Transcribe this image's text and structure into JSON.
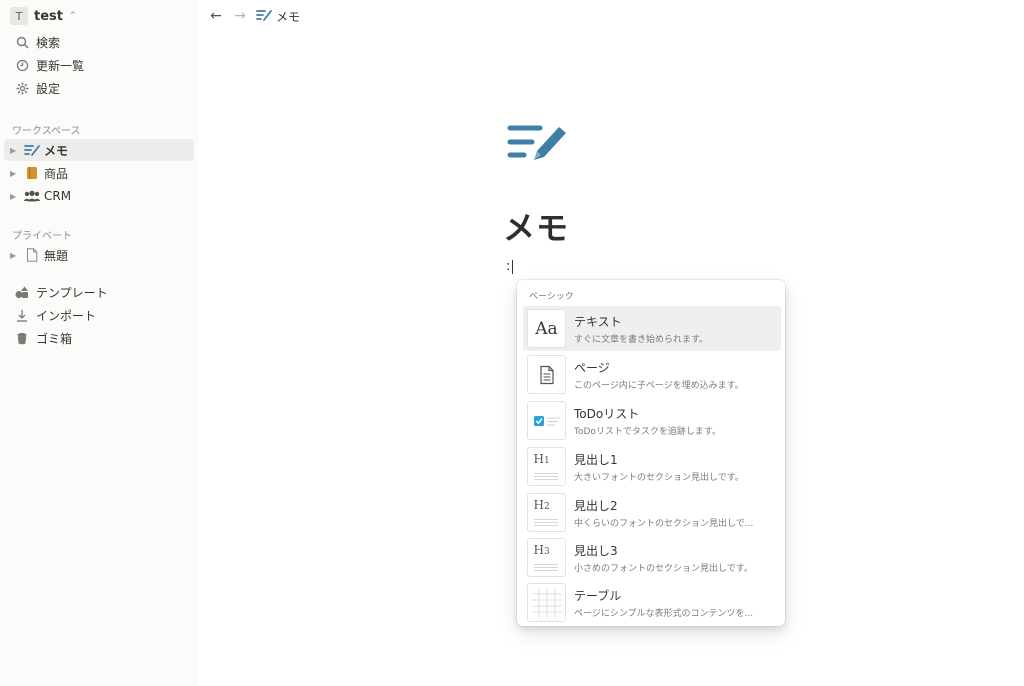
{
  "workspace": {
    "avatar_letter": "T",
    "name": "test",
    "switch_icon": "chevron-updown-icon"
  },
  "sidebar": {
    "top_items": [
      {
        "label": "検索",
        "icon": "search-icon"
      },
      {
        "label": "更新一覧",
        "icon": "clock-icon"
      },
      {
        "label": "設定",
        "icon": "gear-icon"
      }
    ],
    "workspace_section_label": "ワークスペース",
    "workspace_pages": [
      {
        "label": "メモ",
        "icon": "memo-pen-icon",
        "active": true
      },
      {
        "label": "商品",
        "icon": "book-icon",
        "active": false
      },
      {
        "label": "CRM",
        "icon": "people-icon",
        "active": false
      }
    ],
    "private_section_label": "プライベート",
    "private_pages": [
      {
        "label": "無題",
        "icon": "document-icon"
      }
    ],
    "bottom_items": [
      {
        "label": "テンプレート",
        "icon": "shapes-icon"
      },
      {
        "label": "インポート",
        "icon": "download-icon"
      },
      {
        "label": "ゴミ箱",
        "icon": "trash-icon"
      }
    ]
  },
  "topbar": {
    "back_icon": "arrow-left-icon",
    "forward_icon": "arrow-right-icon",
    "breadcrumb_label": "メモ"
  },
  "page": {
    "title": "メモ",
    "slash_text": ":",
    "icon_color": "#3f7fa6"
  },
  "menu": {
    "section_label": "ベーシック",
    "items": [
      {
        "title": "テキスト",
        "desc": "すぐに文章を書き始められます。",
        "thumb": "Aa"
      },
      {
        "title": "ページ",
        "desc": "このページ内に子ページを埋め込みます。",
        "thumb": "page-icon"
      },
      {
        "title": "ToDoリスト",
        "desc": "ToDoリストでタスクを追跡します。",
        "thumb": "checkbox-icon"
      },
      {
        "title": "見出し1",
        "desc": "大きいフォントのセクション見出しです。",
        "thumb": "H1"
      },
      {
        "title": "見出し2",
        "desc": "中くらいのフォントのセクション見出しで...",
        "thumb": "H2"
      },
      {
        "title": "見出し3",
        "desc": "小さめのフォントのセクション見出しです。",
        "thumb": "H3"
      },
      {
        "title": "テーブル",
        "desc": "ページにシンプルな表形式のコンテンツを...",
        "thumb": "table-icon"
      }
    ]
  },
  "colors": {
    "sidebar_bg": "#fbfbfa",
    "active_row": "#ececeb",
    "accent_blue": "#3f7fa6",
    "book_orange": "#d9922e"
  }
}
